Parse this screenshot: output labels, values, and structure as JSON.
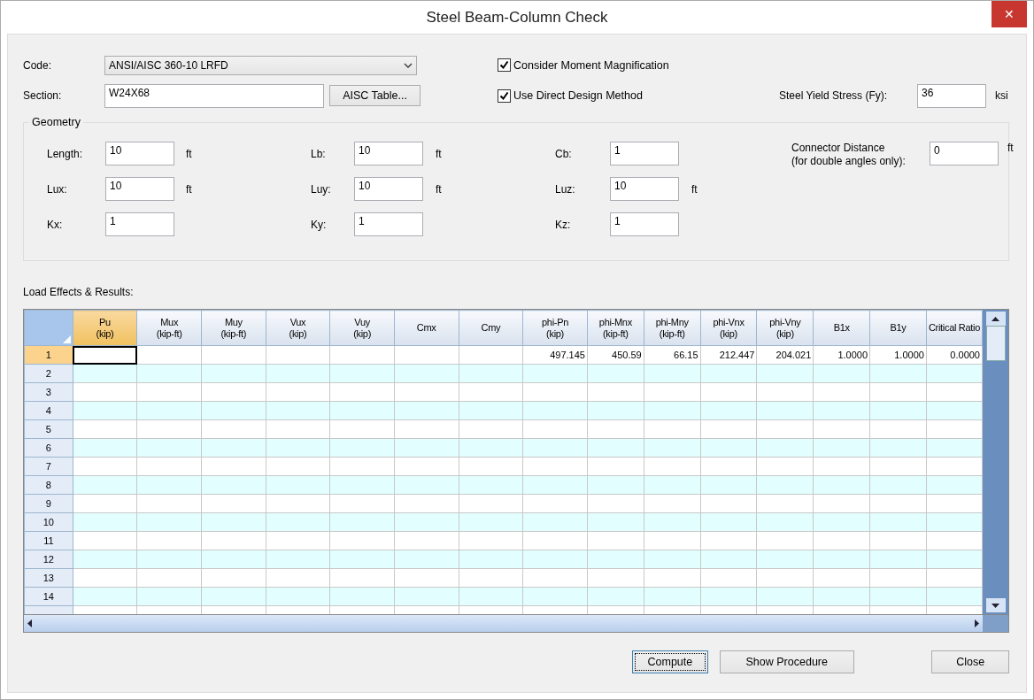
{
  "window": {
    "title": "Steel Beam-Column Check",
    "close": "✕"
  },
  "code": {
    "label": "Code:",
    "value": "ANSI/AISC 360-10 LRFD"
  },
  "section": {
    "label": "Section:",
    "value": "W24X68",
    "button": "AISC Table..."
  },
  "options": [
    {
      "label": "Consider Moment Magnification",
      "checked": true
    },
    {
      "label": "Use Direct Design Method",
      "checked": true
    }
  ],
  "yield": {
    "label": "Steel Yield Stress (Fy):",
    "value": "36",
    "unit": "ksi"
  },
  "geometry": {
    "title": "Geometry",
    "columns": [
      [
        {
          "label": "Length:",
          "value": "10",
          "unit": "ft"
        },
        {
          "label": "Lux:",
          "value": "10",
          "unit": "ft"
        },
        {
          "label": "Kx:",
          "value": "1"
        }
      ],
      [
        {
          "label": "Lb:",
          "value": "10",
          "unit": "ft"
        },
        {
          "label": "Luy:",
          "value": "10",
          "unit": "ft"
        },
        {
          "label": "Ky:",
          "value": "1"
        }
      ],
      [
        {
          "label": "Cb:",
          "value": "1"
        },
        {
          "label": "Luz:",
          "value": "10",
          "unit": "ft"
        },
        {
          "label": "Kz:",
          "value": "1"
        }
      ]
    ],
    "connector": {
      "label": "Connector Distance",
      "note": "(for double angles only):",
      "value": "0",
      "unit": "ft"
    }
  },
  "results": {
    "title": "Load Effects & Results:",
    "columns": [
      {
        "kind": "input",
        "name": "Pu",
        "unit": "(kip)",
        "selected": true
      },
      {
        "kind": "input",
        "name": "Mux",
        "unit": "(kip-ft)",
        "selected": false
      },
      {
        "kind": "input",
        "name": "Muy",
        "unit": "(kip-ft)",
        "selected": false
      },
      {
        "kind": "input",
        "name": "Vux",
        "unit": "(kip)",
        "selected": false
      },
      {
        "kind": "input",
        "name": "Vuy",
        "unit": "(kip)",
        "selected": false
      },
      {
        "kind": "input",
        "name": "Cmx",
        "selected": false
      },
      {
        "kind": "input",
        "name": "Cmy",
        "selected": false
      },
      {
        "kind": "result",
        "name": "phi-Pn",
        "unit": "(kip)",
        "selected": false
      },
      {
        "kind": "result",
        "name": "phi-Mnx",
        "unit": "(kip-ft)",
        "selected": false
      },
      {
        "kind": "result",
        "name": "phi-Mny",
        "unit": "(kip-ft)",
        "selected": false
      },
      {
        "kind": "result",
        "name": "phi-Vnx",
        "unit": "(kip)",
        "selected": false
      },
      {
        "kind": "result",
        "name": "phi-Vny",
        "unit": "(kip)",
        "selected": false
      },
      {
        "kind": "result",
        "name": "B1x",
        "selected": false
      },
      {
        "kind": "result",
        "name": "B1y",
        "selected": false
      },
      {
        "kind": "result",
        "name": "Critical Ratio",
        "selected": false
      }
    ],
    "rows": [
      {
        "label": "1",
        "selected": true,
        "results": [
          "497.145",
          "450.59",
          "66.15",
          "212.447",
          "204.021",
          "1.0000",
          "1.0000",
          "0.0000"
        ]
      },
      {
        "label": "2",
        "selected": false
      },
      {
        "label": "3",
        "selected": false
      },
      {
        "label": "4",
        "selected": false
      },
      {
        "label": "5",
        "selected": false
      },
      {
        "label": "6",
        "selected": false
      },
      {
        "label": "7",
        "selected": false
      },
      {
        "label": "8",
        "selected": false
      },
      {
        "label": "9",
        "selected": false
      },
      {
        "label": "10",
        "selected": false
      },
      {
        "label": "11",
        "selected": false
      },
      {
        "label": "12",
        "selected": false
      },
      {
        "label": "13",
        "selected": false
      },
      {
        "label": "14",
        "selected": false
      }
    ]
  },
  "buttons": [
    {
      "label": "Compute",
      "focused": true
    },
    {
      "label": "Show Procedure",
      "focused": false
    },
    {
      "label": "Close",
      "focused": false
    }
  ]
}
